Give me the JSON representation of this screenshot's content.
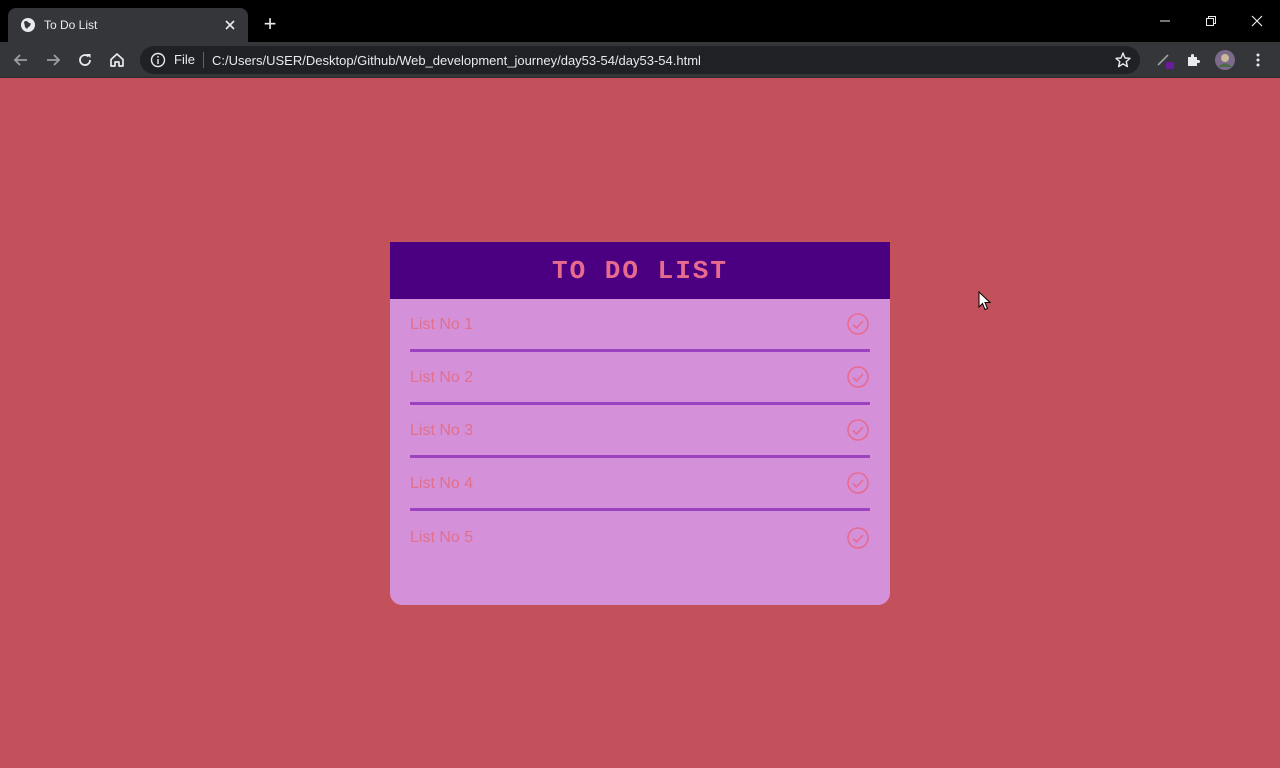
{
  "browser": {
    "tab_title": "To Do List",
    "new_tab_label": "+",
    "scheme_label": "File",
    "url": "C:/Users/USER/Desktop/Github/Web_development_journey/day53-54/day53-54.html"
  },
  "page": {
    "title": "TO DO LIST",
    "items": [
      {
        "label": "List No 1"
      },
      {
        "label": "List No 2"
      },
      {
        "label": "List No 3"
      },
      {
        "label": "List No 4"
      },
      {
        "label": "List No 5"
      }
    ]
  },
  "colors": {
    "page_background": "#c2515b",
    "header_background": "#4b0082",
    "card_background": "#d491d9",
    "accent_text": "#e96a8f",
    "divider": "#9a42c0"
  },
  "icons": [
    "globe-icon",
    "close-icon",
    "minimize-icon",
    "restore-icon",
    "back-icon",
    "forward-icon",
    "reload-icon",
    "home-icon",
    "info-icon",
    "star-icon",
    "extension-icon",
    "puzzle-icon",
    "avatar",
    "menu-icon",
    "check-circle-icon"
  ]
}
